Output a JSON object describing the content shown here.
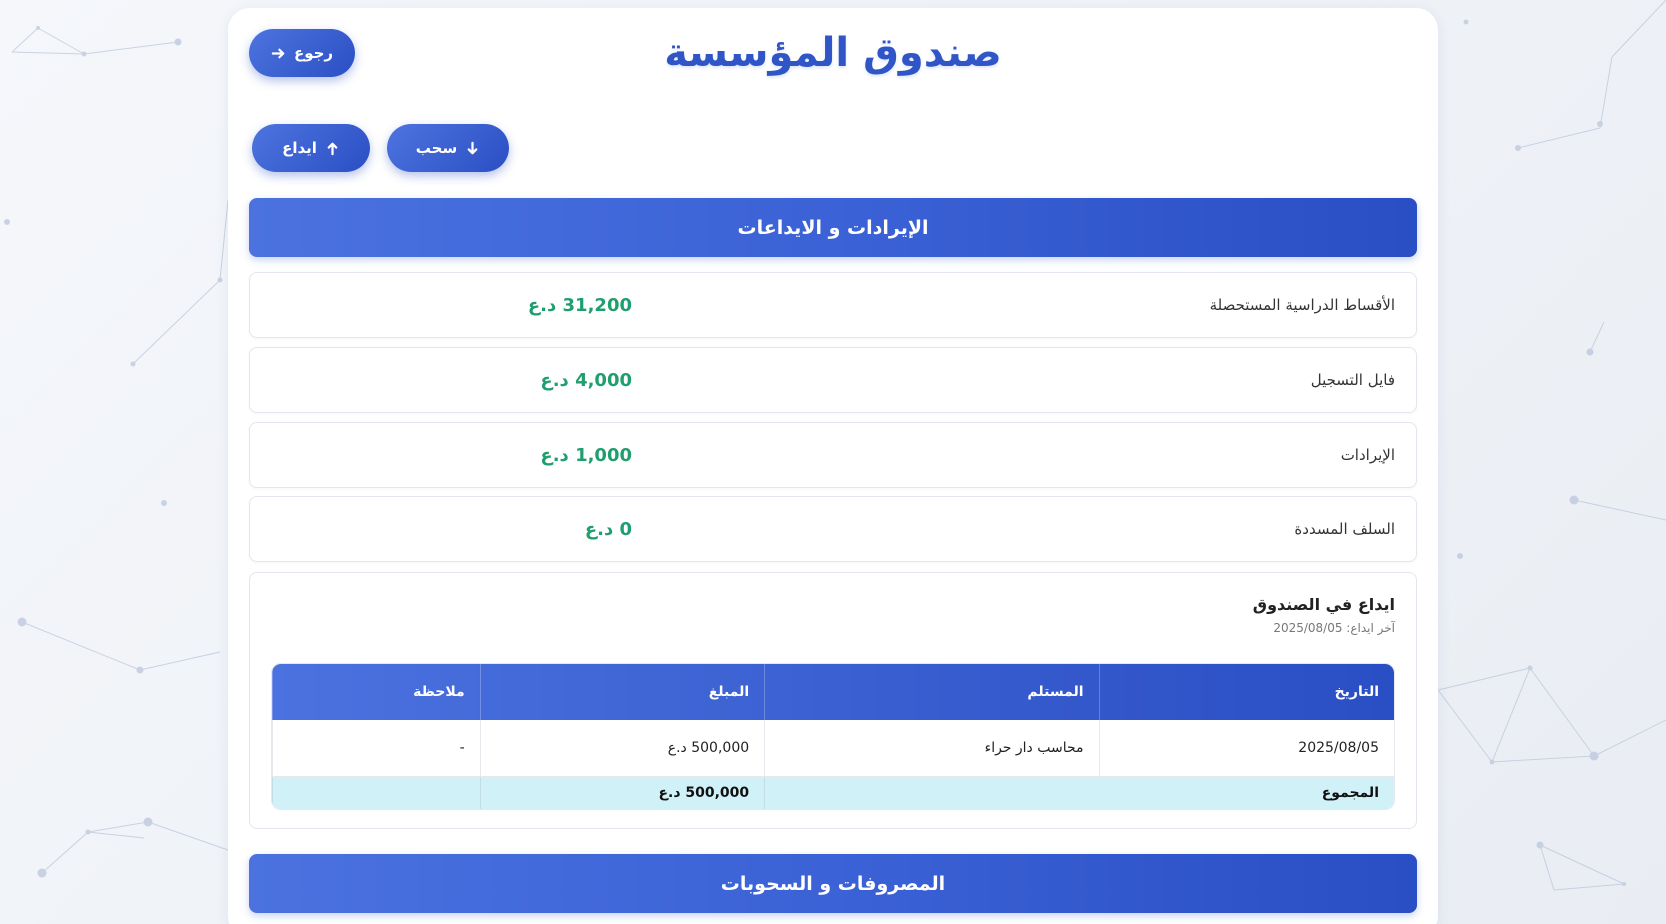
{
  "page": {
    "title": "صندوق المؤسسة"
  },
  "toolbar": {
    "back_label": "رجوع",
    "back_icon": "arrow-right-icon",
    "deposit_label": "ايداع",
    "deposit_icon": "arrow-up-icon",
    "withdraw_label": "سحب",
    "withdraw_icon": "arrow-down-icon"
  },
  "revenue_section": {
    "title": "الإيرادات و الايداعات",
    "rows": [
      {
        "label": "الأقساط الدراسية المستحصلة",
        "value": "31,200 د.ع"
      },
      {
        "label": "فايل التسجيل",
        "value": "4,000 د.ع"
      },
      {
        "label": "الإيرادات",
        "value": "1,000 د.ع"
      },
      {
        "label": "السلف المسددة",
        "value": "0 د.ع"
      }
    ]
  },
  "deposit_box": {
    "title": "ايداع في الصندوق",
    "subtitle": "آخر ايداع: 2025/08/05",
    "table": {
      "headers": [
        "التاريخ",
        "المستلم",
        "المبلغ",
        "ملاحظة"
      ],
      "rows": [
        [
          "2025/08/05",
          "محاسب دار حراء",
          "500,000 د.ع",
          "-"
        ]
      ],
      "footer": {
        "label": "المجموع",
        "total": "500,000 د.ع",
        "note": ""
      }
    }
  },
  "expenses_section": {
    "title": "المصروفات و السحوبات"
  },
  "colors": {
    "accent": "#2f55c7",
    "positive": "#1f9e6e",
    "footer_bg": "#d0f1f8"
  }
}
